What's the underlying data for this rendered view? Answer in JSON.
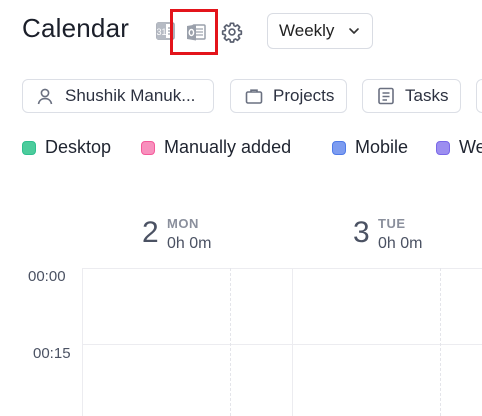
{
  "header": {
    "title": "Calendar",
    "view_select": {
      "value": "Weekly"
    }
  },
  "filters": {
    "member": "Shushik Manuk...",
    "projects": "Projects",
    "tasks": "Tasks"
  },
  "legend": [
    {
      "label": "Desktop",
      "color": "#2fbf8f",
      "fill": "#4ccc9c"
    },
    {
      "label": "Manually added",
      "color": "#f45a9a",
      "fill": "#f890bd"
    },
    {
      "label": "Mobile",
      "color": "#4f7be8",
      "fill": "#7d9cf0"
    },
    {
      "label": "We",
      "color": "#7a68e8",
      "fill": "#9c8ef0"
    }
  ],
  "days": [
    {
      "num": "2",
      "name": "MON",
      "hours": "0h 0m"
    },
    {
      "num": "3",
      "name": "TUE",
      "hours": "0h 0m"
    }
  ],
  "times": [
    "00:00",
    "00:15"
  ],
  "colors": {
    "highlight": "#e3141b",
    "grid": "#ececf0"
  }
}
